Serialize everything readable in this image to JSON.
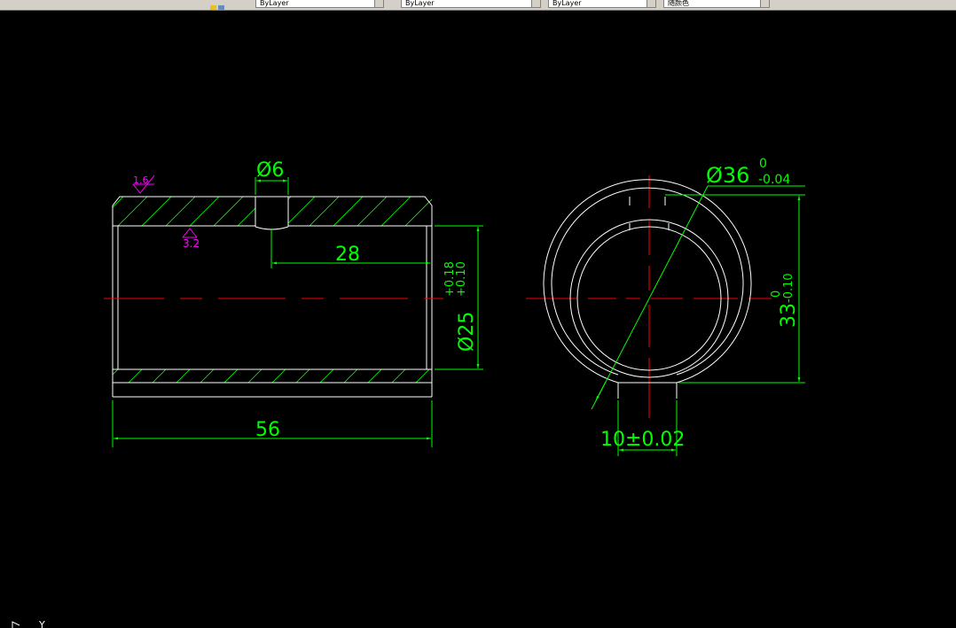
{
  "toolbar": {
    "fields": [
      {
        "label": "ByLayer"
      },
      {
        "label": "ByLayer"
      },
      {
        "label": "ByLayer"
      },
      {
        "label": "随颜色"
      }
    ]
  },
  "drawing": {
    "dims": {
      "hole_dia": "Ø6",
      "roughness_outer": "1.6",
      "roughness_inner": "3.2",
      "hole_pos": "28",
      "bore_dia": "Ø25",
      "bore_tol_upper": "+0.18",
      "bore_tol_lower": "+0.10",
      "length": "56",
      "outer_dia": "Ø36",
      "outer_tol_upper": "0",
      "outer_tol_lower": "-0.04",
      "height": "33",
      "height_tol_upper": "0",
      "height_tol_lower": "-0.10",
      "slot_width": "10±0.02"
    }
  },
  "colors": {
    "background": "#000000",
    "outline": "#ffffff",
    "dimension": "#00ff00",
    "centerline": "#ff0000",
    "roughness": "#ff00ff"
  },
  "ucs": {
    "y_label": "Y"
  }
}
